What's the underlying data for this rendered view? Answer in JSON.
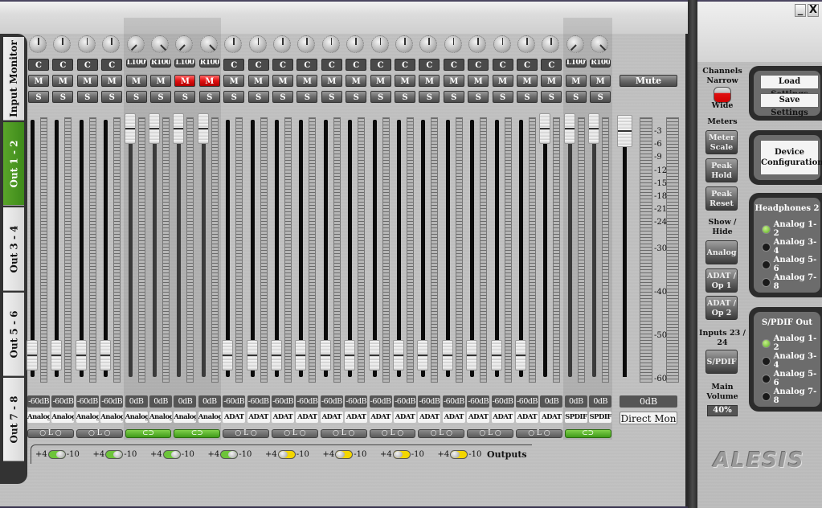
{
  "window": {
    "minimize_label": "_",
    "close_label": "X"
  },
  "tabs": [
    {
      "label": "Input Monitor",
      "active": false
    },
    {
      "label": "Out 1 - 2",
      "active": true
    },
    {
      "label": "Out 3 - 4",
      "active": false
    },
    {
      "label": "Out 5 - 6",
      "active": false
    },
    {
      "label": "Out 7 - 8",
      "active": false
    }
  ],
  "channels": [
    {
      "pan": "C",
      "mute": "M",
      "solo": "S",
      "muted": false,
      "level": "-60dB",
      "source": "Analog",
      "fader_db": -60,
      "link": "off",
      "highlight": false
    },
    {
      "pan": "C",
      "mute": "M",
      "solo": "S",
      "muted": false,
      "level": "-60dB",
      "source": "Analog",
      "fader_db": -60,
      "link": "off",
      "highlight": false
    },
    {
      "pan": "C",
      "mute": "M",
      "solo": "S",
      "muted": false,
      "level": "-60dB",
      "source": "Analog",
      "fader_db": -60,
      "link": "off",
      "highlight": false
    },
    {
      "pan": "C",
      "mute": "M",
      "solo": "S",
      "muted": false,
      "level": "-60dB",
      "source": "Analog",
      "fader_db": -60,
      "link": "off",
      "highlight": false
    },
    {
      "pan": "L100%",
      "mute": "M",
      "solo": "S",
      "muted": false,
      "level": "0dB",
      "source": "Analog",
      "fader_db": 0,
      "link": "on",
      "highlight": true
    },
    {
      "pan": "R100%",
      "mute": "M",
      "solo": "S",
      "muted": false,
      "level": "0dB",
      "source": "Analog",
      "fader_db": 0,
      "link": "on",
      "highlight": true
    },
    {
      "pan": "L100%",
      "mute": "M",
      "solo": "S",
      "muted": true,
      "level": "0dB",
      "source": "Analog",
      "fader_db": 0,
      "link": "on",
      "highlight": true
    },
    {
      "pan": "R100%",
      "mute": "M",
      "solo": "S",
      "muted": true,
      "level": "0dB",
      "source": "Analog",
      "fader_db": 0,
      "link": "on",
      "highlight": true
    },
    {
      "pan": "C",
      "mute": "M",
      "solo": "S",
      "muted": false,
      "level": "-60dB",
      "source": "ADAT",
      "fader_db": -60,
      "link": "off",
      "highlight": false
    },
    {
      "pan": "C",
      "mute": "M",
      "solo": "S",
      "muted": false,
      "level": "-60dB",
      "source": "ADAT",
      "fader_db": -60,
      "link": "off",
      "highlight": false
    },
    {
      "pan": "C",
      "mute": "M",
      "solo": "S",
      "muted": false,
      "level": "-60dB",
      "source": "ADAT",
      "fader_db": -60,
      "link": "off",
      "highlight": false
    },
    {
      "pan": "C",
      "mute": "M",
      "solo": "S",
      "muted": false,
      "level": "-60dB",
      "source": "ADAT",
      "fader_db": -60,
      "link": "off",
      "highlight": false
    },
    {
      "pan": "C",
      "mute": "M",
      "solo": "S",
      "muted": false,
      "level": "-60dB",
      "source": "ADAT",
      "fader_db": -60,
      "link": "off",
      "highlight": false
    },
    {
      "pan": "C",
      "mute": "M",
      "solo": "S",
      "muted": false,
      "level": "-60dB",
      "source": "ADAT",
      "fader_db": -60,
      "link": "off",
      "highlight": false
    },
    {
      "pan": "C",
      "mute": "M",
      "solo": "S",
      "muted": false,
      "level": "-60dB",
      "source": "ADAT",
      "fader_db": -60,
      "link": "off",
      "highlight": false
    },
    {
      "pan": "C",
      "mute": "M",
      "solo": "S",
      "muted": false,
      "level": "-60dB",
      "source": "ADAT",
      "fader_db": -60,
      "link": "off",
      "highlight": false
    },
    {
      "pan": "C",
      "mute": "M",
      "solo": "S",
      "muted": false,
      "level": "-60dB",
      "source": "ADAT",
      "fader_db": -60,
      "link": "off",
      "highlight": false
    },
    {
      "pan": "C",
      "mute": "M",
      "solo": "S",
      "muted": false,
      "level": "-60dB",
      "source": "ADAT",
      "fader_db": -60,
      "link": "off",
      "highlight": false
    },
    {
      "pan": "C",
      "mute": "M",
      "solo": "S",
      "muted": false,
      "level": "-60dB",
      "source": "ADAT",
      "fader_db": -60,
      "link": "off",
      "highlight": false
    },
    {
      "pan": "C",
      "mute": "M",
      "solo": "S",
      "muted": false,
      "level": "-60dB",
      "source": "ADAT",
      "fader_db": -60,
      "link": "off",
      "highlight": false
    },
    {
      "pan": "C",
      "mute": "M",
      "solo": "S",
      "muted": false,
      "level": "-60dB",
      "source": "ADAT",
      "fader_db": -60,
      "link": "off",
      "highlight": false
    },
    {
      "pan": "C",
      "mute": "M",
      "solo": "S",
      "muted": false,
      "level": "0dB",
      "source": "ADAT",
      "fader_db": 0,
      "link": "off",
      "highlight": false
    },
    {
      "pan": "L100%",
      "mute": "M",
      "solo": "S",
      "muted": false,
      "level": "0dB",
      "source": "SPDIF",
      "fader_db": 0,
      "link": "on",
      "highlight": true
    },
    {
      "pan": "R100%",
      "mute": "M",
      "solo": "S",
      "muted": false,
      "level": "0dB",
      "source": "SPDIF",
      "fader_db": 0,
      "link": "on",
      "highlight": true
    }
  ],
  "pan_link_labels": {
    "off": "○ L ○",
    "on": "⊂⊃"
  },
  "output_switches": [
    {
      "left": "+4",
      "right": "-10",
      "state": "+4",
      "color": "green"
    },
    {
      "left": "+4",
      "right": "-10",
      "state": "+4",
      "color": "green"
    },
    {
      "left": "+4",
      "right": "-10",
      "state": "+4",
      "color": "green"
    },
    {
      "left": "+4",
      "right": "-10",
      "state": "+4",
      "color": "green"
    },
    {
      "left": "+4",
      "right": "-10",
      "state": "-10",
      "color": "yellow"
    },
    {
      "left": "+4",
      "right": "-10",
      "state": "-10",
      "color": "yellow"
    },
    {
      "left": "+4",
      "right": "-10",
      "state": "-10",
      "color": "yellow"
    },
    {
      "left": "+4",
      "right": "-10",
      "state": "-10",
      "color": "yellow"
    }
  ],
  "outputs_label": "Outputs",
  "master": {
    "mute_label": "Mute",
    "level": "0dB",
    "direct_mon_label": "Direct Mon",
    "fader_db": 0,
    "scale": [
      "-3",
      "-6",
      "-9",
      "-12",
      "-15",
      "-18",
      "-21",
      "-24",
      "-30",
      "-40",
      "-50",
      "-60"
    ]
  },
  "side": {
    "channels_label": "Channels",
    "narrow_label": "Narrow",
    "wide_label": "Wide",
    "channels_mode": "Wide",
    "meters_label": "Meters",
    "meter_scale_label": "Meter Scale",
    "peak_hold_label": "Peak Hold",
    "peak_reset_label": "Peak Reset",
    "show_hide_label": "Show / Hide",
    "analog_label": "Analog",
    "adat1_label": "ADAT / Op 1",
    "adat2_label": "ADAT / Op 2",
    "inputs_label": "Inputs 23 / 24",
    "spdif_label": "S/PDIF",
    "main_volume_label": "Main Volume",
    "main_volume": "40%",
    "load_settings": "Load Settings",
    "save_settings": "Save Settings",
    "device_config": "Device Configuration",
    "headphones": {
      "title": "Headphones 2",
      "options": [
        "Analog 1-2",
        "Analog 3-4",
        "Analog 5-6",
        "Analog 7-8"
      ],
      "selected": 0
    },
    "spdif_out": {
      "title": "S/PDIF Out",
      "options": [
        "Analog 1-2",
        "Analog 3-4",
        "Analog 5-6",
        "Analog 7-8"
      ],
      "selected": 0
    },
    "logo": "ALESIS"
  }
}
